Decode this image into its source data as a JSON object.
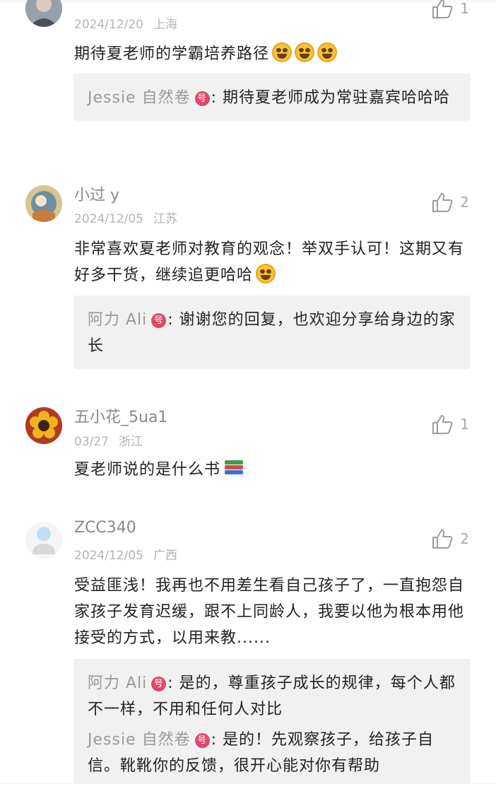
{
  "colors": {
    "accent_badge": "#e0476c",
    "reply_bg": "#f1f1f1",
    "name_gray": "#8a8a8a",
    "meta_gray": "#b3b3b3"
  },
  "comments": [
    {
      "username": "",
      "date": "2024/12/20",
      "location": "上海",
      "likes": "1",
      "text": "期待夏老师的学霸培养路径",
      "emoji": [
        "star-struck-face",
        "star-struck-face",
        "star-struck-face"
      ],
      "replies": [
        {
          "name": "Jessie 自然卷",
          "badge": "号",
          "text": ": 期待夏老师成为常驻嘉宾哈哈哈"
        }
      ]
    },
    {
      "username": "小过 y",
      "date": "2024/12/05",
      "location": "江苏",
      "likes": "2",
      "text": "非常喜欢夏老师对教育的观念！举双手认可！这期又有好多干货，继续追更哈哈",
      "emoji": [
        "grinning-face"
      ],
      "replies": [
        {
          "name": "阿力 Ali",
          "badge": "号",
          "text": ": 谢谢您的回复，也欢迎分享给身边的家长"
        }
      ]
    },
    {
      "username": "五小花_5ua1",
      "date": "03/27",
      "location": "浙江",
      "likes": "1",
      "text": "夏老师说的是什么书",
      "emoji": [
        "books"
      ],
      "replies": []
    },
    {
      "username": "ZCC340",
      "date": "2024/12/05",
      "location": "广西",
      "likes": "2",
      "text": "受益匪浅！我再也不用差生看自己孩子了，一直抱怨自家孩子发育迟缓，跟不上同龄人，我要以他为根本用他接受的方式，以用来教......",
      "emoji": [],
      "replies": [
        {
          "name": "阿力 Ali",
          "badge": "号",
          "text": ": 是的，尊重孩子成长的规律，每个人都不一样，不用和任何人对比"
        },
        {
          "name": "Jessie 自然卷",
          "badge": "号",
          "text": ": 是的！先观察孩子，给孩子自信。靴靴你的反馈，很开心能对你有帮助"
        }
      ]
    }
  ]
}
